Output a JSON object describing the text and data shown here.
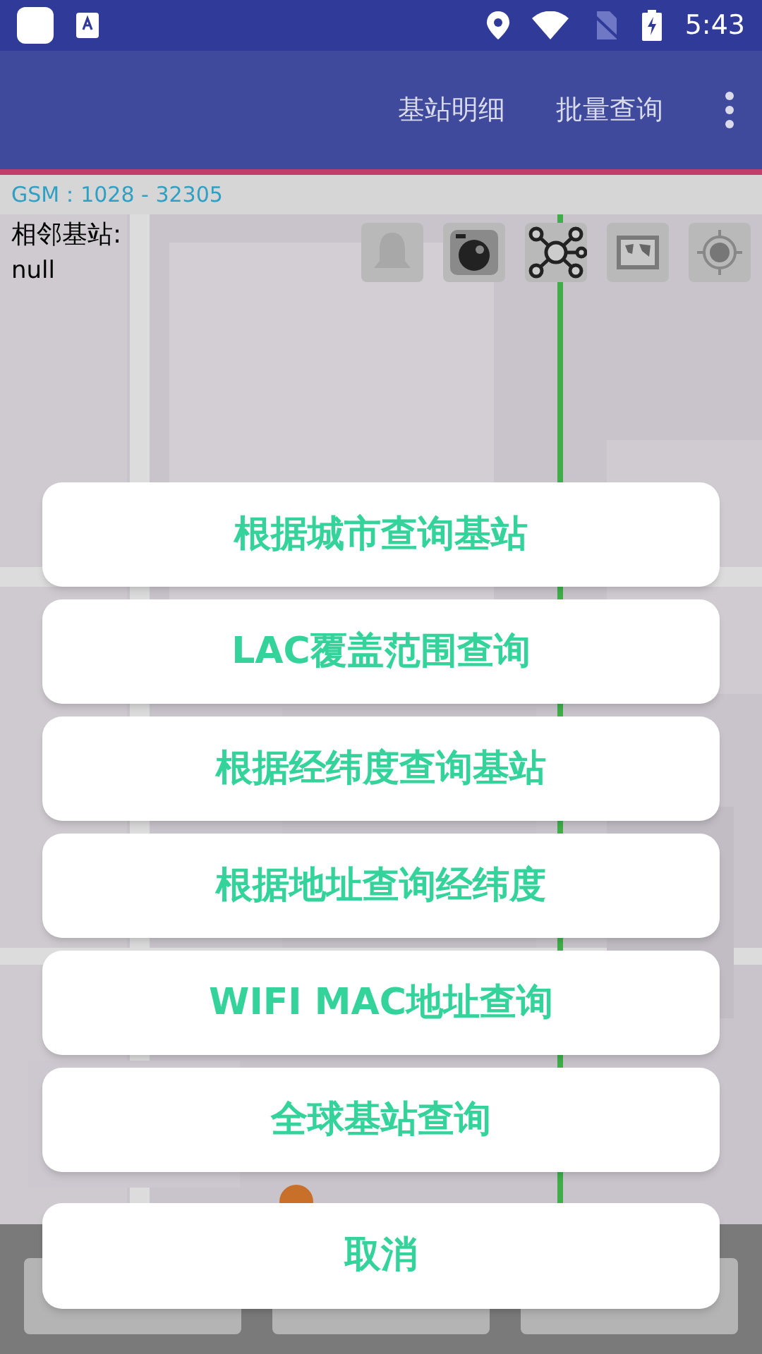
{
  "status_bar": {
    "time": "5:43"
  },
  "toolbar": {
    "actions": [
      "基站明细",
      "批量查询"
    ]
  },
  "cell_info": {
    "gsm": "GSM：1028 - 32305",
    "neighbor_label": "相邻基站:",
    "neighbor_value": "null"
  },
  "action_sheet": {
    "options": [
      "根据城市查询基站",
      "LAC覆盖范围查询",
      "根据经纬度查询基站",
      "根据地址查询经纬度",
      "WIFI MAC地址查询",
      "全球基站查询"
    ],
    "cancel": "取消"
  }
}
